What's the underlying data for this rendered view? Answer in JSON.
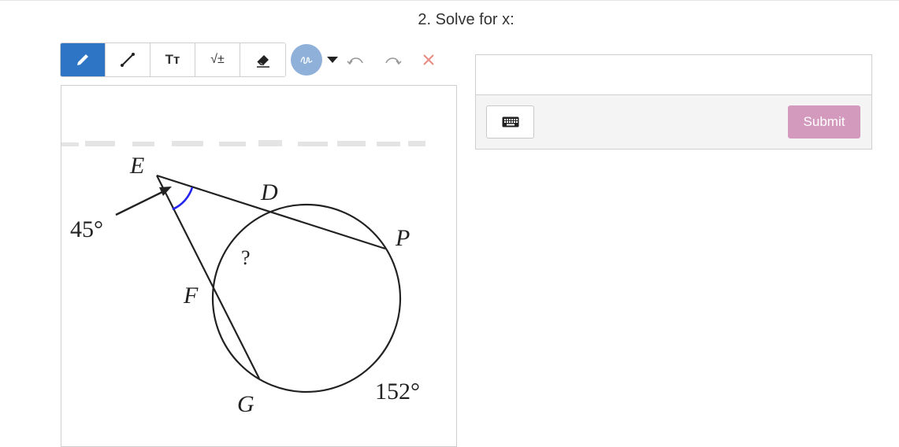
{
  "question": {
    "title": "2. Solve for x:"
  },
  "toolbar": {
    "tools": [
      {
        "name": "pencil-icon",
        "active": true
      },
      {
        "name": "line-icon",
        "active": false
      },
      {
        "name": "text-size-icon",
        "label": "Tт",
        "active": false
      },
      {
        "name": "math-icon",
        "label": "√±",
        "active": false
      },
      {
        "name": "eraser-icon",
        "active": false
      }
    ],
    "color_swatch": "#8fb0d8",
    "active_color": "#2e75c6",
    "history": [
      "undo-icon",
      "redo-icon",
      "clear-icon"
    ]
  },
  "figure": {
    "points": {
      "E": "E",
      "D": "D",
      "P": "P",
      "F": "F",
      "G": "G"
    },
    "angle_label": "45°",
    "unknown_label": "?",
    "arc_label": "152°"
  },
  "answer": {
    "input_value": "",
    "keyboard_icon": "keyboard-icon",
    "submit_label": "Submit",
    "submit_color": "#d49abe"
  }
}
